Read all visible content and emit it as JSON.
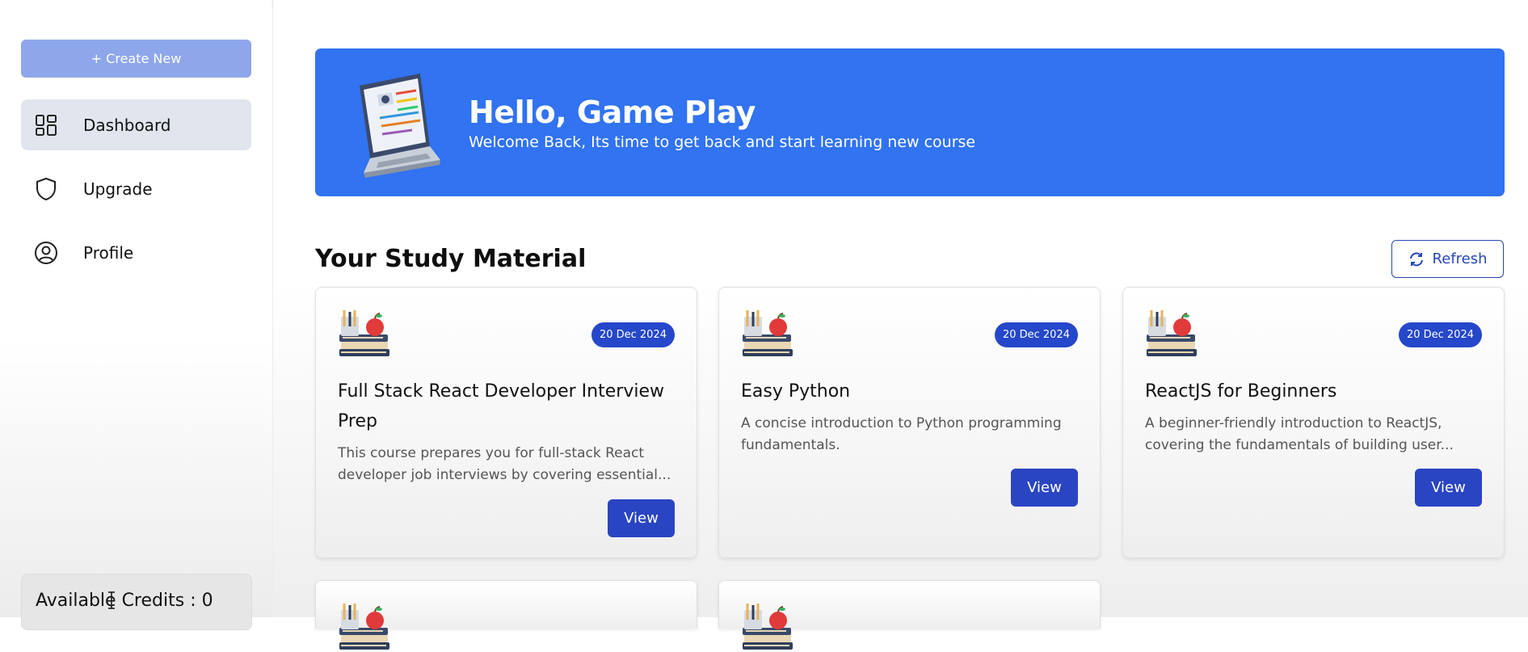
{
  "sidebar": {
    "create_label": "+ Create New",
    "items": [
      {
        "label": "Dashboard",
        "icon": "dashboard-icon",
        "active": true
      },
      {
        "label": "Upgrade",
        "icon": "shield-icon",
        "active": false
      },
      {
        "label": "Profile",
        "icon": "user-circle-icon",
        "active": false
      }
    ],
    "credits_label": "Available Credits : 0"
  },
  "banner": {
    "title": "Hello, Game Play",
    "subtitle": "Welcome Back, Its time to get back and start learning new course",
    "bg_color": "#3173f0"
  },
  "section": {
    "title": "Your Study Material",
    "refresh_label": "Refresh"
  },
  "courses": [
    {
      "date": "20 Dec 2024",
      "title": "Full Stack React Developer Interview Prep",
      "desc": "This course prepares you for full-stack React developer job interviews by covering essential...",
      "view_label": "View"
    },
    {
      "date": "20 Dec 2024",
      "title": "Easy Python",
      "desc": "A concise introduction to Python programming fundamentals.",
      "view_label": "View"
    },
    {
      "date": "20 Dec 2024",
      "title": "ReactJS for Beginners",
      "desc": "A beginner-friendly introduction to ReactJS, covering the fundamentals of building user...",
      "view_label": "View"
    }
  ],
  "colors": {
    "accent": "#2547c9",
    "create_button": "#8ea7ea",
    "active_nav": "#e0e5ee"
  }
}
